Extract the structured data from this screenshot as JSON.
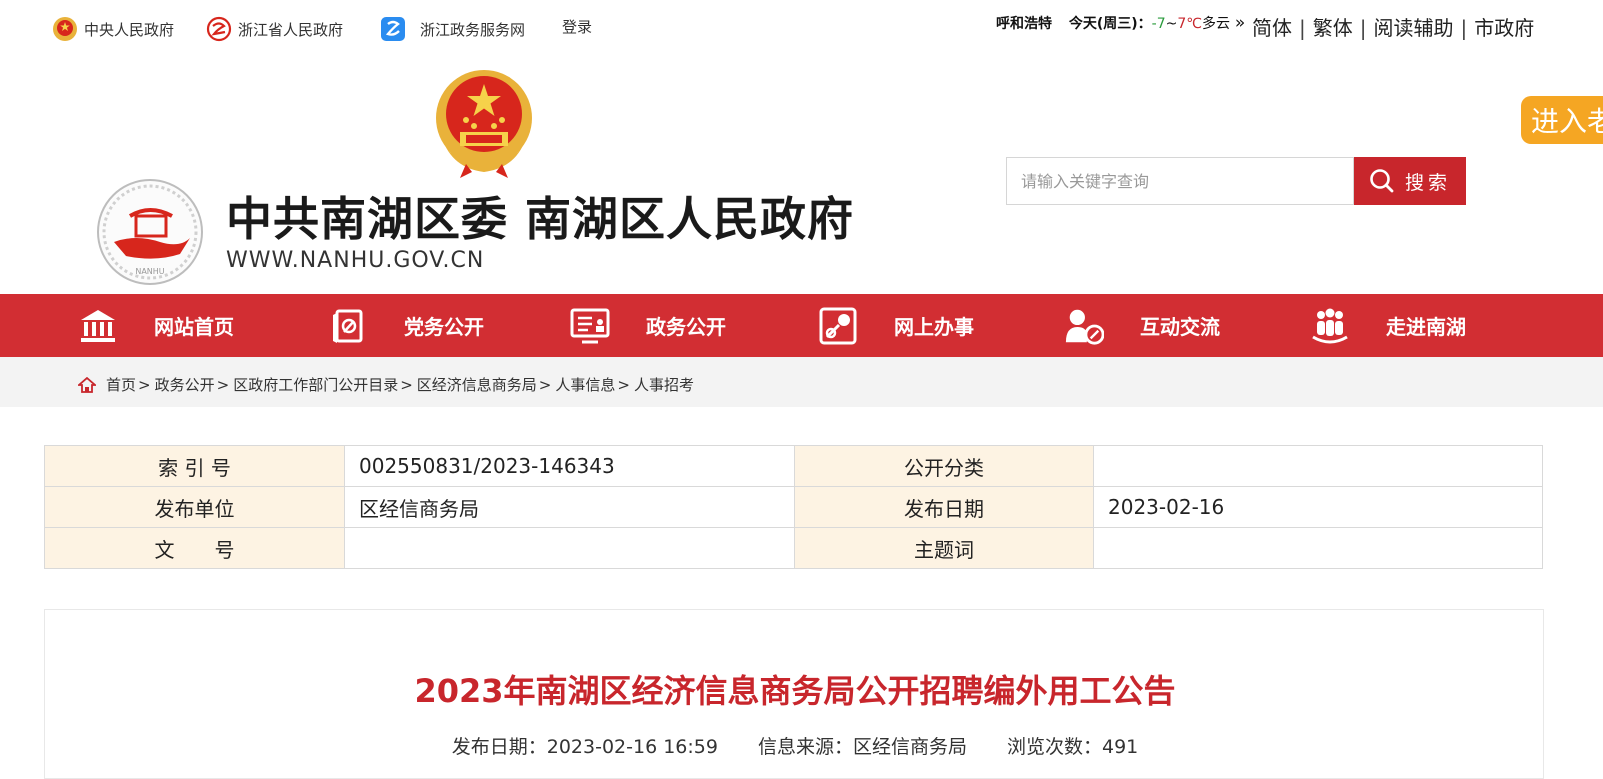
{
  "topbar": {
    "links": [
      {
        "label": "中央人民政府"
      },
      {
        "label": "浙江省人民政府"
      },
      {
        "label": "浙江政务服务网"
      },
      {
        "label": "登录"
      }
    ],
    "weather": {
      "city": "呼和浩特",
      "today": "今天(周三)：",
      "low": "-7",
      "tilde": "~",
      "high": "7℃",
      "desc": "多云",
      "arrow": "»"
    },
    "tools": [
      "简体",
      "繁体",
      "阅读辅助",
      "市政府"
    ],
    "separator": "|"
  },
  "header": {
    "title": "中共南湖区委 南湖区人民政府",
    "url": "WWW.NANHU.GOV.CN"
  },
  "search": {
    "placeholder": "请输入关键字查询",
    "button_label": "搜索"
  },
  "side_tab": {
    "label": "进入老"
  },
  "nav": {
    "items": [
      {
        "label": "网站首页",
        "icon": "building-icon"
      },
      {
        "label": "党务公开",
        "icon": "party-book-icon"
      },
      {
        "label": "政务公开",
        "icon": "board-icon"
      },
      {
        "label": "网上办事",
        "icon": "online-service-icon"
      },
      {
        "label": "互动交流",
        "icon": "user-chat-icon"
      },
      {
        "label": "走进南湖",
        "icon": "people-group-icon"
      }
    ]
  },
  "breadcrumb": {
    "items": [
      "首页",
      "政务公开",
      "区政府工作部门公开目录",
      "区经济信息商务局",
      "人事信息",
      "人事招考"
    ],
    "sep": ">"
  },
  "meta": {
    "rows": [
      {
        "k1": "索 引 号",
        "v1": "002550831/2023-146343",
        "k2": "公开分类",
        "v2": ""
      },
      {
        "k1": "发布单位",
        "v1": "区经信商务局",
        "k2": "发布日期",
        "v2": "2023-02-16"
      },
      {
        "k1": "文　　号",
        "v1": "",
        "k2": "主题词",
        "v2": ""
      }
    ]
  },
  "article": {
    "title": "2023年南湖区经济信息商务局公开招聘编外用工公告",
    "date_label": "发布日期：2023-02-16 16:59",
    "source_label": "信息来源：区经信商务局",
    "views_label": "浏览次数：",
    "views": "491"
  },
  "colors": {
    "brand_red": "#d22e33",
    "accent_orange": "#f5a623",
    "meta_bg": "#fdf3e3"
  }
}
